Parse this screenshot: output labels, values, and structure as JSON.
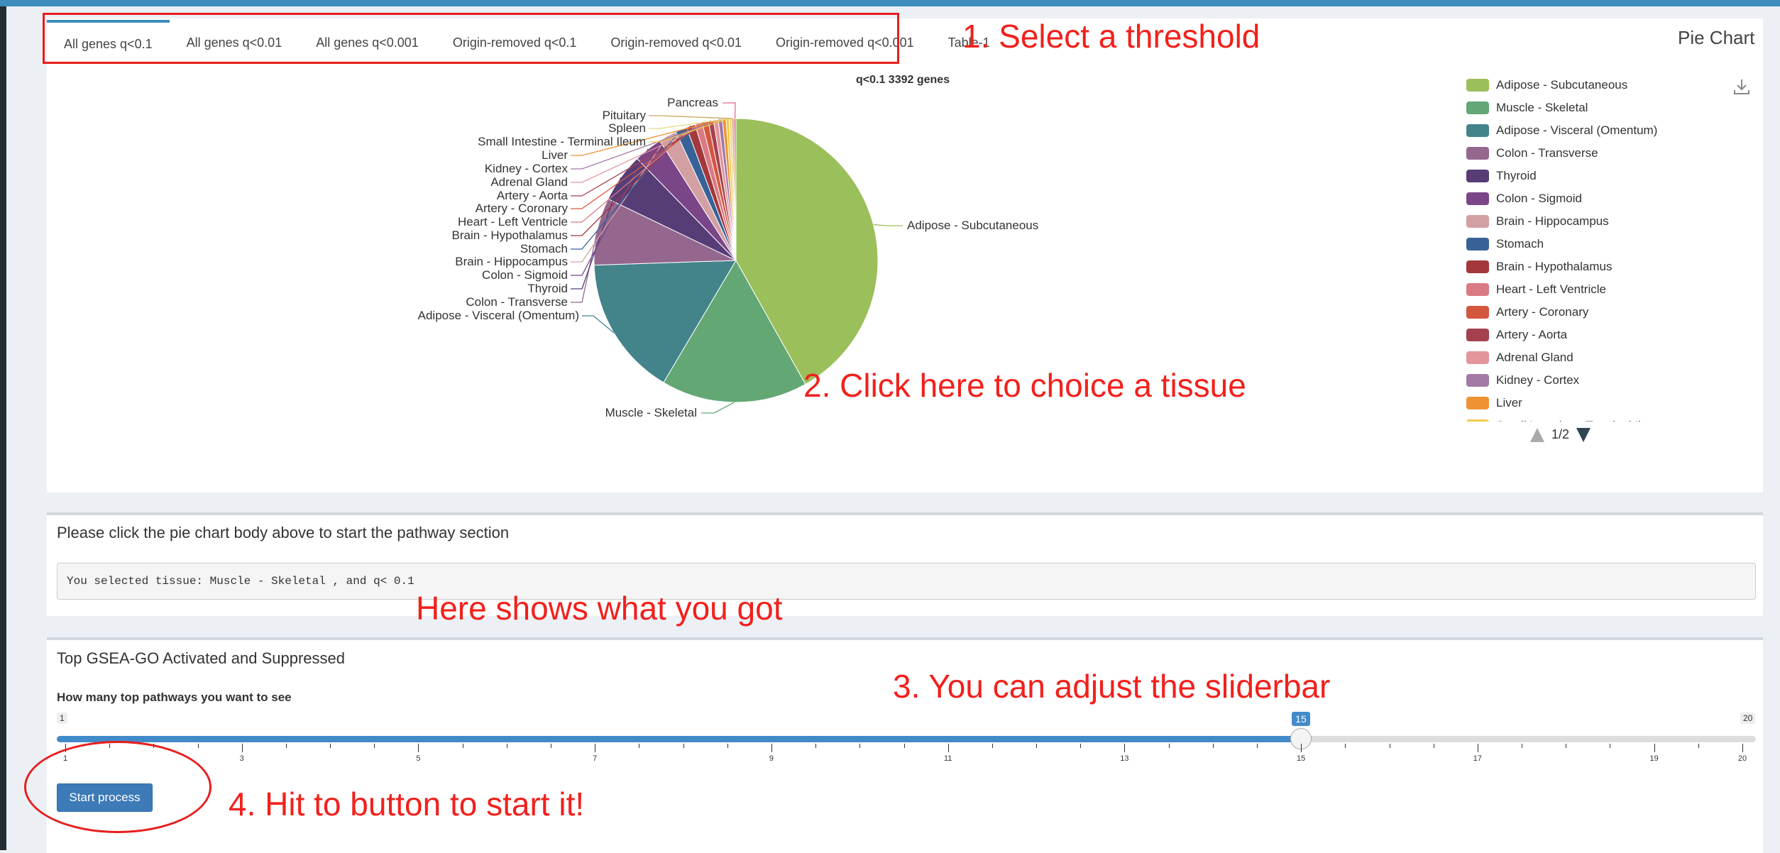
{
  "tabs": [
    {
      "label": "All genes q<0.1",
      "active": true
    },
    {
      "label": "All genes q<0.01",
      "active": false
    },
    {
      "label": "All genes q<0.001",
      "active": false
    },
    {
      "label": "Origin-removed q<0.1",
      "active": false
    },
    {
      "label": "Origin-removed q<0.01",
      "active": false
    },
    {
      "label": "Origin-removed q<0.001",
      "active": false
    },
    {
      "label": "Table-1",
      "active": false
    }
  ],
  "tabbox_title": "Pie Chart",
  "annotations": {
    "step1": "1. Select a threshold",
    "step2": "2. Click here to choice a tissue",
    "shows": "Here shows what you got",
    "step3": "3. You can adjust the sliderbar",
    "step4": "4. Hit to button to start it!"
  },
  "chart_data": {
    "type": "pie",
    "title": "q<0.1 3392 genes",
    "slices": [
      {
        "label": "Adipose - Subcutaneous",
        "value": 1420,
        "color": "#9bbf5b"
      },
      {
        "label": "Muscle - Skeletal",
        "value": 565,
        "color": "#62a774"
      },
      {
        "label": "Adipose - Visceral (Omentum)",
        "value": 541,
        "color": "#43848b"
      },
      {
        "label": "Colon - Transverse",
        "value": 260,
        "color": "#95678f"
      },
      {
        "label": "Thyroid",
        "value": 190,
        "color": "#563d76"
      },
      {
        "label": "Colon - Sigmoid",
        "value": 110,
        "color": "#7b4688"
      },
      {
        "label": "Brain - Hippocampus",
        "value": 70,
        "color": "#d2a0a3"
      },
      {
        "label": "Stomach",
        "value": 44,
        "color": "#386297"
      },
      {
        "label": "Brain - Hypothalamus",
        "value": 34,
        "color": "#a2383c"
      },
      {
        "label": "Heart - Left Ventricle",
        "value": 28,
        "color": "#da7a82"
      },
      {
        "label": "Artery - Coronary",
        "value": 24,
        "color": "#d3573e"
      },
      {
        "label": "Artery - Aorta",
        "value": 20,
        "color": "#a5414f"
      },
      {
        "label": "Adrenal Gland",
        "value": 18,
        "color": "#e3959b"
      },
      {
        "label": "Kidney - Cortex",
        "value": 16,
        "color": "#a27aa6"
      },
      {
        "label": "Liver",
        "value": 14,
        "color": "#ee9233"
      },
      {
        "label": "Small Intestine - Terminal Ileum",
        "value": 12,
        "color": "#f3c94a"
      },
      {
        "label": "Spleen",
        "value": 10,
        "color": "#e8d77e"
      },
      {
        "label": "Pituitary",
        "value": 8,
        "color": "#c9a75f"
      },
      {
        "label": "Pancreas",
        "value": 8,
        "color": "#e56b8c"
      }
    ],
    "legend_placement": "right"
  },
  "legend": {
    "visible_labels": [
      "Adipose - Subcutaneous",
      "Muscle - Skeletal",
      "Adipose - Visceral (Omentum)",
      "Colon - Transverse",
      "Thyroid",
      "Colon - Sigmoid",
      "Brain - Hippocampus",
      "Stomach",
      "Brain - Hypothalamus",
      "Heart - Left Ventricle",
      "Artery - Coronary",
      "Artery - Aorta",
      "Adrenal Gland",
      "Kidney - Cortex",
      "Liver",
      "Small Intestine - Terminal Ileum"
    ],
    "page": "1/2"
  },
  "selection": {
    "title": "Please click the pie chart body above to start the pathway section",
    "output": "You selected tissue: Muscle - Skeletal , and q< 0.1"
  },
  "gsea": {
    "title": "Top GSEA-GO Activated and Suppressed",
    "slider_label": "How many top pathways you want to see",
    "min": 1,
    "max": 20,
    "value": 15,
    "min_label": "1",
    "max_label": "20",
    "value_label": "15",
    "tick_labels": [
      "1",
      "3",
      "5",
      "7",
      "9",
      "11",
      "13",
      "15",
      "17",
      "19",
      "20"
    ],
    "button": "Start process"
  }
}
